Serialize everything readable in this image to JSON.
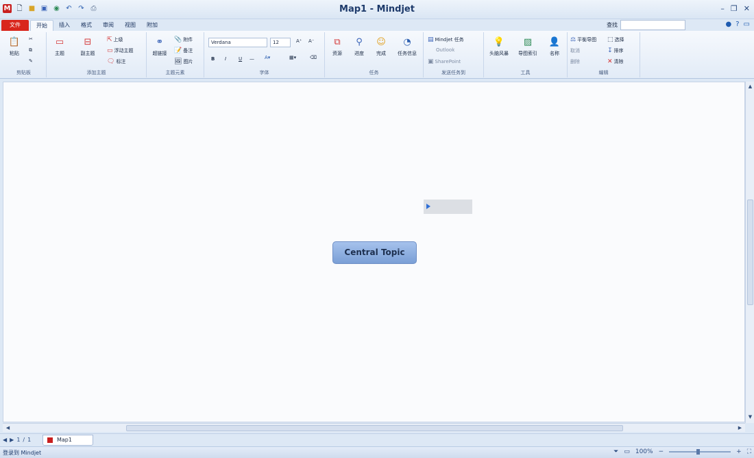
{
  "titlebar": {
    "title": "Map1 - Mindjet",
    "qa_icons": [
      "logo-icon",
      "new-icon",
      "open-icon",
      "save-icon",
      "globe-icon",
      "undo-icon",
      "redo-icon",
      "print-icon"
    ],
    "logo_letter": "M",
    "minimize": "–",
    "restore": "❐",
    "close": "✕"
  },
  "tabs": {
    "file": "文件",
    "items": [
      "开始",
      "插入",
      "格式",
      "审阅",
      "视图",
      "附加"
    ],
    "active": "开始",
    "search_label": "查找"
  },
  "ribbon": {
    "groups": [
      {
        "title": "剪贴板",
        "buttons": [
          "粘贴"
        ]
      },
      {
        "title": "添加主题",
        "buttons": [
          "主题",
          "副主题"
        ],
        "smalls": [
          "上级",
          "浮动主题",
          "标注"
        ]
      },
      {
        "title": "主题元素",
        "buttons": [
          "超链接"
        ],
        "smalls": [
          "附件",
          "备注",
          "图片"
        ]
      },
      {
        "title": "字体",
        "font": "Verdana",
        "size": "12",
        "bold": "B",
        "italic": "I",
        "underline": "U"
      },
      {
        "title": "任务",
        "buttons": [
          "资源",
          "进度",
          "完成",
          "任务信息"
        ]
      },
      {
        "title": "发送任务到",
        "smalls": [
          "Mindjet 任务",
          "Outlook",
          "SharePoint"
        ]
      },
      {
        "title": "工具",
        "buttons": [
          "头脑风暴",
          "导图索引",
          "名称"
        ]
      },
      {
        "title": "编辑",
        "smalls": [
          "平衡导图",
          "选择",
          "取消",
          "排序",
          "删除",
          "清除"
        ]
      }
    ]
  },
  "canvas": {
    "central_topic": "Central Topic"
  },
  "doctabs": {
    "nav": [
      "◀",
      "▶",
      "1",
      "/",
      "1"
    ],
    "tab_label": "Map1"
  },
  "status": {
    "left_text": "登录到 Mindjet",
    "zoom": "100%"
  }
}
